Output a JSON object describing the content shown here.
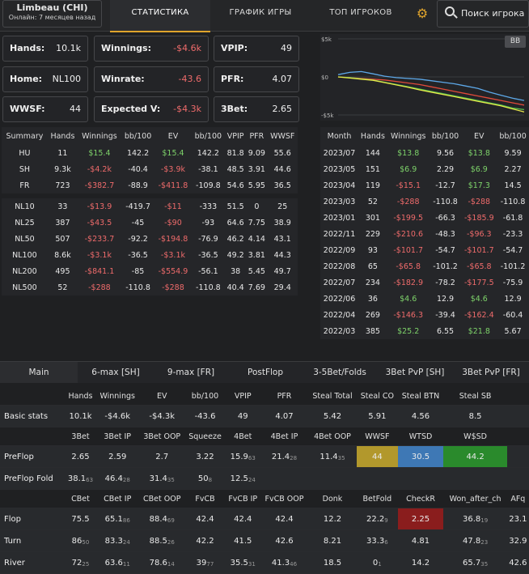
{
  "header": {
    "player_name": "Limbeau (CHI)",
    "status": "Онлайн: 7 месяцев назад",
    "tabs": [
      "СТАТИСТИКА",
      "ГРАФИК ИГРЫ",
      "ТОП ИГРОКОВ"
    ],
    "active_tab": "СТАТИСТИКА",
    "search_placeholder": "Поиск игрока",
    "settings_icon": "gear-icon",
    "search_icon": "search-icon",
    "accent_color": "#e0a42c"
  },
  "key_stats": [
    {
      "label": "Hands:",
      "value": "10.1k"
    },
    {
      "label": "Winnings:",
      "value": "-$4.6k"
    },
    {
      "label": "VPIP:",
      "value": "49"
    },
    {
      "label": "Home:",
      "value": "NL100"
    },
    {
      "label": "Winrate:",
      "value": "-43.6"
    },
    {
      "label": "PFR:",
      "value": "4.07"
    },
    {
      "label": "WWSF:",
      "value": "44"
    },
    {
      "label": "Expected V:",
      "value": "-$4.3k"
    },
    {
      "label": "3Bet:",
      "value": "2.65"
    }
  ],
  "chart_data": {
    "type": "line",
    "unit_toggle": "BB",
    "y_ticks": [
      "$5k",
      "$0",
      "-$5k"
    ],
    "ylim": [
      -5000,
      5000
    ],
    "series": [
      {
        "color": "#5da8e8",
        "values": [
          300,
          600,
          700,
          400,
          100,
          -100,
          -200,
          -300,
          -500,
          -700,
          -900,
          -1200,
          -1500,
          -2000,
          -2400,
          -2800,
          -3100
        ]
      },
      {
        "color": "#e04a3a",
        "values": [
          0,
          -100,
          -200,
          -300,
          -400,
          -600,
          -800,
          -1000,
          -1300,
          -1600,
          -1900,
          -2200,
          -2500,
          -2800,
          -3100,
          -3400,
          -3700
        ]
      },
      {
        "color": "#58c04a",
        "values": [
          0,
          -100,
          -250,
          -400,
          -700,
          -1000,
          -1300,
          -1600,
          -1900,
          -2200,
          -2500,
          -2800,
          -3100,
          -3400,
          -3700,
          -4100,
          -4300
        ]
      },
      {
        "color": "#e6e64a",
        "values": [
          0,
          -150,
          -300,
          -450,
          -750,
          -1050,
          -1350,
          -1700,
          -2000,
          -2300,
          -2600,
          -2900,
          -3200,
          -3500,
          -3800,
          -4200,
          -4600
        ]
      }
    ]
  },
  "summary_table": {
    "headers": [
      "Summary",
      "Hands",
      "Winnings",
      "bb/100",
      "EV",
      "bb/100",
      "VPIP",
      "PFR",
      "WWSF"
    ],
    "group1": [
      [
        "HU",
        "11",
        "$15.4",
        "142.2",
        "$15.4",
        "142.2",
        "81.8",
        "9.09",
        "55.6"
      ],
      [
        "SH",
        "9.3k",
        "-$4.2k",
        "-40.4",
        "-$3.9k",
        "-38.1",
        "48.5",
        "3.91",
        "44.6"
      ],
      [
        "FR",
        "723",
        "-$382.7",
        "-88.9",
        "-$411.8",
        "-109.8",
        "54.6",
        "5.95",
        "36.5"
      ]
    ],
    "group2": [
      [
        "NL10",
        "33",
        "-$13.9",
        "-419.7",
        "-$11",
        "-333",
        "51.5",
        "0",
        "25"
      ],
      [
        "NL25",
        "387",
        "-$43.5",
        "-45",
        "-$90",
        "-93",
        "64.6",
        "7.75",
        "38.9"
      ],
      [
        "NL50",
        "507",
        "-$233.7",
        "-92.2",
        "-$194.8",
        "-76.9",
        "46.2",
        "4.14",
        "43.1"
      ],
      [
        "NL100",
        "8.6k",
        "-$3.1k",
        "-36.5",
        "-$3.1k",
        "-36.5",
        "49.2",
        "3.81",
        "44.3"
      ],
      [
        "NL200",
        "495",
        "-$841.1",
        "-85",
        "-$554.9",
        "-56.1",
        "38",
        "5.45",
        "49.7"
      ],
      [
        "NL500",
        "52",
        "-$288",
        "-110.8",
        "-$288",
        "-110.8",
        "40.4",
        "7.69",
        "29.4"
      ]
    ]
  },
  "month_table": {
    "headers": [
      "Month",
      "Hands",
      "Winnings",
      "bb/100",
      "EV",
      "bb/100"
    ],
    "rows": [
      [
        "2023/07",
        "144",
        "$13.8",
        "9.56",
        "$13.8",
        "9.59"
      ],
      [
        "2023/05",
        "151",
        "$6.9",
        "2.29",
        "$6.9",
        "2.27"
      ],
      [
        "2023/04",
        "119",
        "-$15.1",
        "-12.7",
        "$17.3",
        "14.5"
      ],
      [
        "2023/03",
        "52",
        "-$288",
        "-110.8",
        "-$288",
        "-110.8"
      ],
      [
        "2023/01",
        "301",
        "-$199.5",
        "-66.3",
        "-$185.9",
        "-61.8"
      ],
      [
        "2022/11",
        "229",
        "-$210.6",
        "-48.3",
        "-$96.3",
        "-23.3"
      ],
      [
        "2022/09",
        "93",
        "-$101.7",
        "-54.7",
        "-$101.7",
        "-54.7"
      ],
      [
        "2022/08",
        "65",
        "-$65.8",
        "-101.2",
        "-$65.8",
        "-101.2"
      ],
      [
        "2022/07",
        "234",
        "-$182.9",
        "-78.2",
        "-$177.5",
        "-75.9"
      ],
      [
        "2022/06",
        "36",
        "$4.6",
        "12.9",
        "$4.6",
        "12.9"
      ],
      [
        "2022/04",
        "269",
        "-$146.3",
        "-39.4",
        "-$162.4",
        "-60.4"
      ],
      [
        "2022/03",
        "385",
        "$25.2",
        "6.55",
        "$21.8",
        "5.67"
      ]
    ]
  },
  "detail_tabs": [
    "Main",
    "6-max [SH]",
    "9-max [FR]",
    "PostFlop",
    "3-5Bet/Folds",
    "3Bet PvP [SH]",
    "3Bet PvP [FR]"
  ],
  "detail": {
    "h1": [
      "Hands",
      "Winnings",
      "EV",
      "bb/100",
      "VPIP",
      "PFR",
      "Steal Total",
      "Steal CO",
      "Steal BTN",
      "Steal SB"
    ],
    "basic_label": "Basic stats",
    "basic": [
      "10.1k",
      "-$4.6k",
      "-$4.3k",
      "-43.6",
      "49",
      "4.07",
      "5.42",
      "5.91",
      "4.56",
      "8.5"
    ],
    "h2": [
      "3Bet",
      "3Bet IP",
      "3Bet OOP",
      "Squeeze",
      "4Bet",
      "4Bet IP",
      "4Bet OOP",
      "WWSF",
      "WTSD",
      "W$SD"
    ],
    "preflop_label": "PreFlop",
    "preflop": [
      "2.65",
      "2.59",
      "2.7",
      "3.22",
      "15.9",
      "21.4",
      "11.4",
      "44",
      "30.5",
      "44.2"
    ],
    "preflop_sub": [
      "",
      "",
      "",
      "",
      "63",
      "28",
      "35",
      "",
      "",
      ""
    ],
    "pff_label": "PreFlop Fold",
    "pff": [
      "38.1",
      "46.4",
      "31.4",
      "50",
      "12.5",
      "",
      "",
      "",
      "",
      ""
    ],
    "pff_sub": [
      "63",
      "28",
      "35",
      "8",
      "24",
      "",
      "",
      "",
      "",
      ""
    ],
    "h3": [
      "CBet",
      "CBet IP",
      "CBet OOP",
      "FvCB",
      "FvCB IP",
      "FvCB OOP",
      "Donk",
      "BetFold",
      "CheckR",
      "Won_after_ch",
      "AFq"
    ],
    "flop_label": "Flop",
    "flop": [
      "75.5",
      "65.1",
      "88.4",
      "42.4",
      "42.4",
      "42.4",
      "12.2",
      "22.2",
      "2.25",
      "36.8",
      "23.1"
    ],
    "flop_sub": [
      "",
      "86",
      "69",
      "",
      "",
      "",
      "",
      "9",
      "",
      "19",
      ""
    ],
    "turn_label": "Turn",
    "turn": [
      "86",
      "83.3",
      "88.5",
      "42.2",
      "41.5",
      "42.6",
      "8.21",
      "33.3",
      "4.81",
      "47.8",
      "32.9"
    ],
    "turn_sub": [
      "50",
      "24",
      "26",
      "",
      "",
      "",
      "",
      "6",
      "",
      "23",
      ""
    ],
    "river_label": "River",
    "river": [
      "72",
      "63.6",
      "78.6",
      "39",
      "35.5",
      "41.3",
      "18.5",
      "0",
      "14.2",
      "65.7",
      "42.6"
    ],
    "river_sub": [
      "25",
      "11",
      "14",
      "77",
      "31",
      "46",
      "",
      "1",
      "",
      "35",
      ""
    ]
  }
}
